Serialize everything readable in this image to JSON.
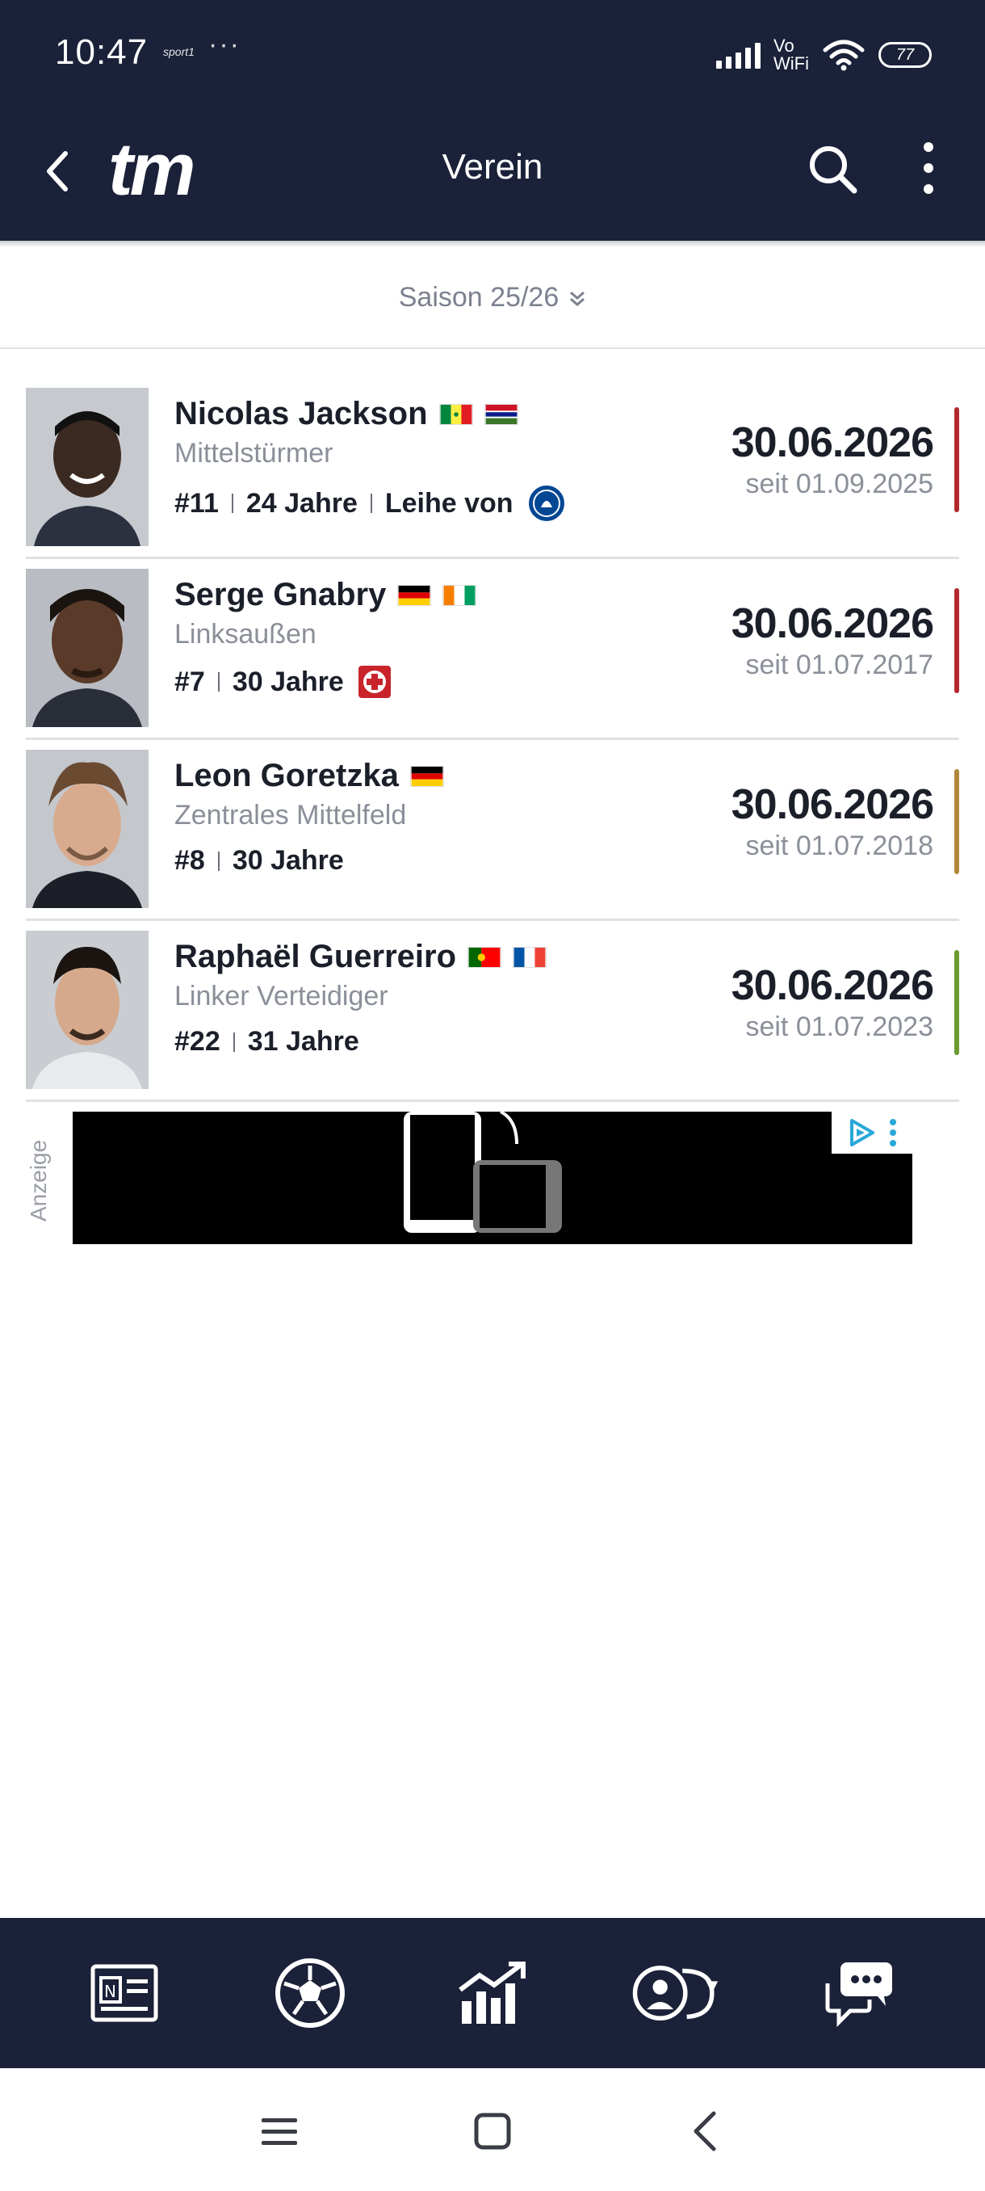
{
  "status_bar": {
    "time": "10:47",
    "app_label": "sport1",
    "dots": "···",
    "network_label_1": "Vo",
    "network_label_2": "WiFi",
    "battery": "77"
  },
  "app_bar": {
    "logo": "tm",
    "title": "Verein"
  },
  "season": {
    "label": "Saison 25/26"
  },
  "players": [
    {
      "name": "Nicolas Jackson",
      "flags": [
        "senegal-flag",
        "gambia-flag"
      ],
      "position": "Mittelstürmer",
      "number": "#11",
      "age": "24 Jahre",
      "loan": "Leihe von",
      "contract_end": "30.06.2026",
      "since": "seit 01.09.2025",
      "strip_color": "#b3282d"
    },
    {
      "name": "Serge Gnabry",
      "flags": [
        "germany-flag",
        "ivory-coast-flag"
      ],
      "position": "Linksaußen",
      "number": "#7",
      "age": "30 Jahre",
      "contract_end": "30.06.2026",
      "since": "seit 01.07.2017",
      "strip_color": "#b3282d"
    },
    {
      "name": "Leon Goretzka",
      "flags": [
        "germany-flag"
      ],
      "position": "Zentrales Mittelfeld",
      "number": "#8",
      "age": "30 Jahre",
      "contract_end": "30.06.2026",
      "since": "seit 01.07.2018",
      "strip_color": "#b0883a"
    },
    {
      "name": "Raphaël Guerreiro",
      "flags": [
        "portugal-flag",
        "france-flag"
      ],
      "position": "Linker Verteidiger",
      "number": "#22",
      "age": "31 Jahre",
      "contract_end": "30.06.2026",
      "since": "seit 01.07.2023",
      "strip_color": "#6b9a2e"
    }
  ],
  "ad": {
    "label": "Anzeige"
  },
  "bottom_nav": [
    "news-icon",
    "football-icon",
    "stats-chart-icon",
    "transfers-icon",
    "chat-icon"
  ],
  "android_nav": [
    "menu-icon",
    "home-icon",
    "back-icon"
  ],
  "colors": {
    "header_bg": "#1a2138",
    "text_primary": "#1b1f2a",
    "text_secondary": "#8a8f99"
  }
}
